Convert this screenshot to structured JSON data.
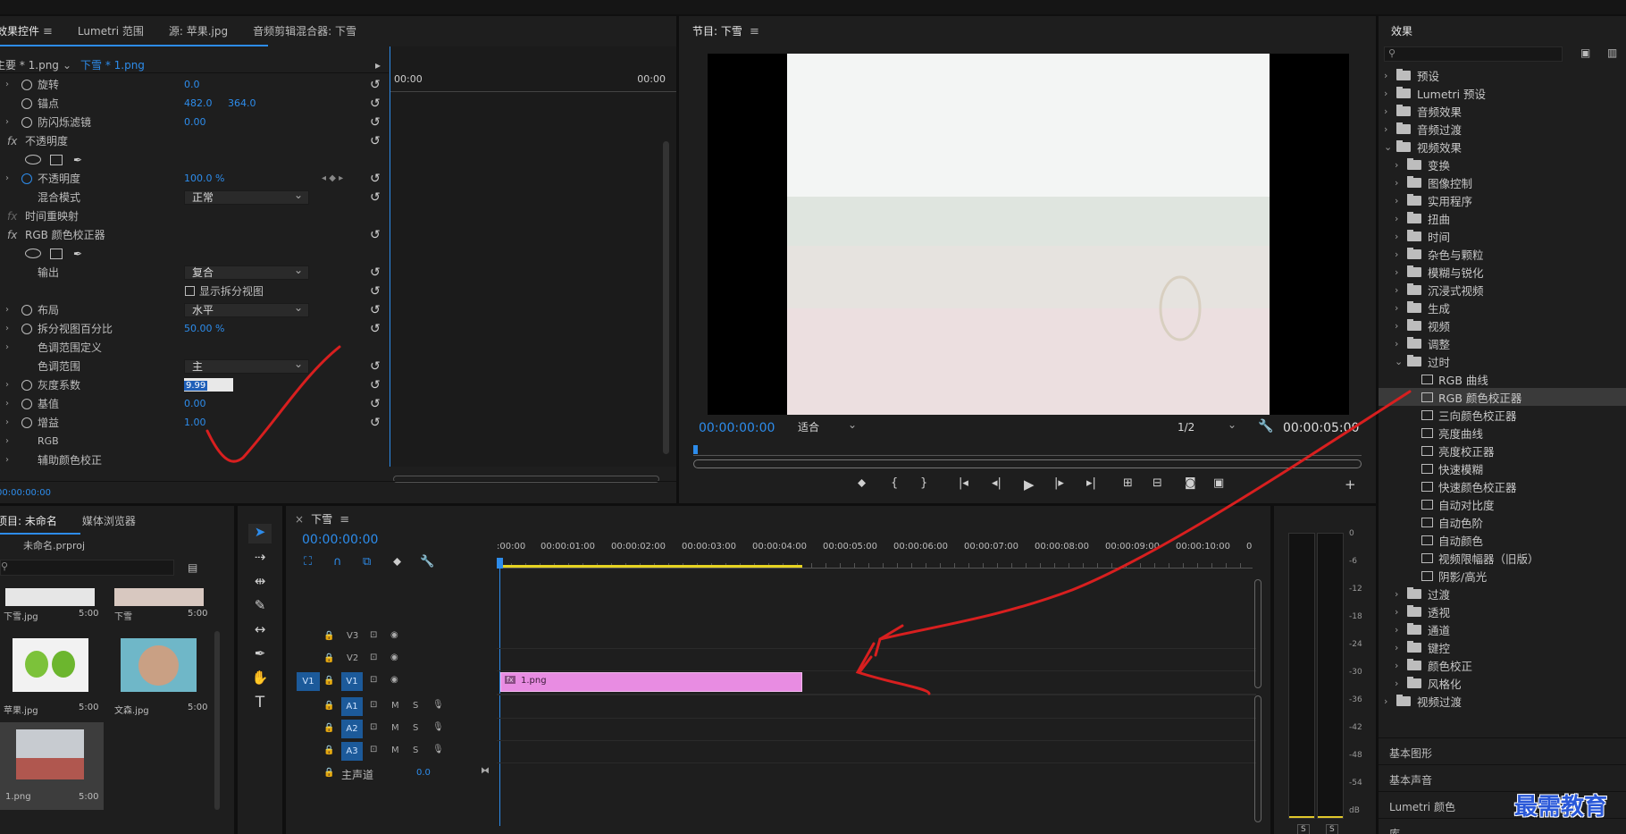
{
  "effect_controls": {
    "tabs": [
      "效果控件",
      "Lumetri 范围",
      "源: 苹果.jpg",
      "音频剪辑混合器: 下雪"
    ],
    "master_clip": "主要 * 1.png",
    "clip": "下雪 * 1.png",
    "time_start": "00:00",
    "time_end": "00:00",
    "rows": {
      "rotation": "旋转",
      "rotation_val": "0.0",
      "anchor": "锚点",
      "anchor_x": "482.0",
      "anchor_y": "364.0",
      "flicker": "防闪烁滤镜",
      "flicker_val": "0.00",
      "opacity_group": "不透明度",
      "opacity": "不透明度",
      "opacity_val": "100.0 %",
      "blend": "混合模式",
      "blend_val": "正常",
      "time_remap": "时间重映射",
      "rgb_group": "RGB 颜色校正器",
      "output": "输出",
      "output_val": "复合",
      "split_label": "显示拆分视图",
      "layout": "布局",
      "layout_val": "水平",
      "split_pct": "拆分视图百分比",
      "split_pct_val": "50.00 %",
      "tonal_def": "色调范围定义",
      "tonal": "色调范围",
      "tonal_val": "主",
      "gamma": "灰度系数",
      "gamma_val": "9.99",
      "pedestal": "基值",
      "pedestal_val": "0.00",
      "gain": "增益",
      "gain_val": "1.00",
      "rgb": "RGB",
      "aux": "辅助颜色校正"
    },
    "footer_time": "00:00:00:00"
  },
  "program": {
    "title": "节目: 下雪",
    "timecode": "00:00:00:00",
    "fit": "适合",
    "quality": "1/2",
    "duration": "00:00:05:00"
  },
  "effects": {
    "title": "效果",
    "top": [
      "预设",
      "Lumetri 预设",
      "音频效果",
      "音频过渡",
      "视频效果"
    ],
    "video_sub": [
      "变换",
      "图像控制",
      "实用程序",
      "扭曲",
      "时间",
      "杂色与颗粒",
      "模糊与锐化",
      "沉浸式视频",
      "生成",
      "视频",
      "调整",
      "过时"
    ],
    "obsolete": [
      "RGB 曲线",
      "RGB 颜色校正器",
      "三向颜色校正器",
      "亮度曲线",
      "亮度校正器",
      "快速模糊",
      "快速颜色校正器",
      "自动对比度",
      "自动色阶",
      "自动颜色",
      "视频限幅器（旧版）",
      "阴影/高光"
    ],
    "after": [
      "过渡",
      "透视",
      "通道",
      "键控",
      "颜色校正",
      "风格化"
    ],
    "last": "视频过渡",
    "panels": [
      "基本图形",
      "基本声音",
      "Lumetri 颜色",
      "库"
    ]
  },
  "project": {
    "tabs": [
      "项目: 未命名",
      "媒体浏览器"
    ],
    "file": "未命名.prproj",
    "items": [
      {
        "name": "下雪.jpg",
        "dur": "5:00"
      },
      {
        "name": "下雪",
        "dur": "5:00"
      },
      {
        "name": "苹果.jpg",
        "dur": "5:00"
      },
      {
        "name": "文森.jpg",
        "dur": "5:00"
      },
      {
        "name": "1.png",
        "dur": "5:00"
      }
    ]
  },
  "timeline": {
    "title": "下雪",
    "timecode": "00:00:00:00",
    "ruler": [
      ":00:00",
      "00:00:01:00",
      "00:00:02:00",
      "00:00:03:00",
      "00:00:04:00",
      "00:00:05:00",
      "00:00:06:00",
      "00:00:07:00",
      "00:00:08:00",
      "00:00:09:00",
      "00:00:10:00",
      "0"
    ],
    "tracks": [
      "V3",
      "V2",
      "V1",
      "A1",
      "A2",
      "A3"
    ],
    "src": "V1",
    "master": "主声道",
    "master_val": "0.0",
    "clip": "1.png",
    "M": "M",
    "S": "S"
  },
  "meter": {
    "ticks": [
      "0",
      "-6",
      "-12",
      "-18",
      "-24",
      "-30",
      "-36",
      "-42",
      "-48",
      "-54",
      "dB"
    ],
    "solo": [
      "S",
      "S"
    ]
  },
  "watermark": "最需教育"
}
